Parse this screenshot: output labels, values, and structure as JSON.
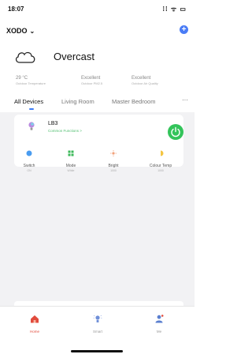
{
  "status": {
    "time": "18:07",
    "icons": "⁞⁞ ᯤ ▭"
  },
  "home": {
    "name": "XODO",
    "add": "+"
  },
  "weather": {
    "condition": "Overcast",
    "stats": [
      {
        "value": "29 °C",
        "label": "Outdoor Temperature"
      },
      {
        "value": "Excellent",
        "label": "Outdoor PM2.5"
      },
      {
        "value": "Excellent",
        "label": "Outdoor Air Quality"
      }
    ]
  },
  "tabs": [
    "All Devices",
    "Living Room",
    "Master Bedroom"
  ],
  "tabs_more": "···",
  "device": {
    "name": "LB3",
    "subtitle": "Common Functions >",
    "functions": [
      {
        "label": "Switch",
        "value": "ON",
        "color": "#4a9cf0"
      },
      {
        "label": "Mode",
        "value": "White",
        "color": "#3cb95a"
      },
      {
        "label": "Bright",
        "value": "1000",
        "color": "#f2a17a"
      },
      {
        "label": "Colour Temp",
        "value": "1000",
        "color": "#f4c542"
      }
    ]
  },
  "tabbar": [
    {
      "label": "Home",
      "icon": "home-icon"
    },
    {
      "label": "Smart",
      "icon": "smart-icon"
    },
    {
      "label": "Me",
      "icon": "me-icon"
    }
  ]
}
